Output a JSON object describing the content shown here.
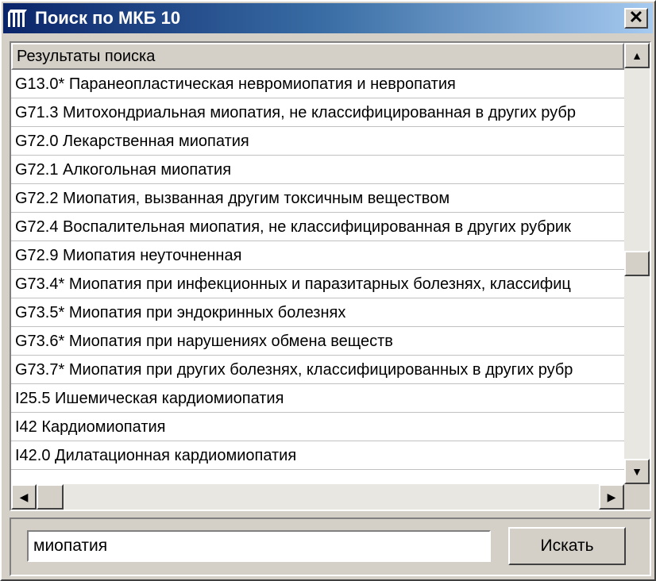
{
  "window": {
    "title": "Поиск по МКБ 10",
    "close_label": "✕"
  },
  "list": {
    "header": "Результаты поиска",
    "rows": [
      "G13.0* Паранеопластическая невромиопатия и невропатия",
      "G71.3 Митохондриальная миопатия, не классифицированная в других рубр",
      "G72.0 Лекарственная миопатия",
      "G72.1 Алкогольная миопатия",
      "G72.2 Миопатия, вызванная другим токсичным веществом",
      "G72.4 Воспалительная миопатия, не классифицированная в других рубрик",
      "G72.9 Миопатия неуточненная",
      "G73.4* Миопатия при инфекционных и паразитарных болезнях, классифиц",
      "G73.5* Миопатия при эндокринных болезнях",
      "G73.6* Миопатия при нарушениях обмена веществ",
      "G73.7* Миопатия при других болезнях, классифицированных в других рубр",
      "I25.5 Ишемическая кардиомиопатия",
      "I42 Кардиомиопатия",
      "I42.0 Дилатационная кардиомиопатия"
    ]
  },
  "scrollbar": {
    "up_arrow": "▲",
    "down_arrow": "▼",
    "left_arrow": "◀",
    "right_arrow": "▶"
  },
  "search": {
    "value": "миопатия",
    "button_label": "Искать"
  }
}
